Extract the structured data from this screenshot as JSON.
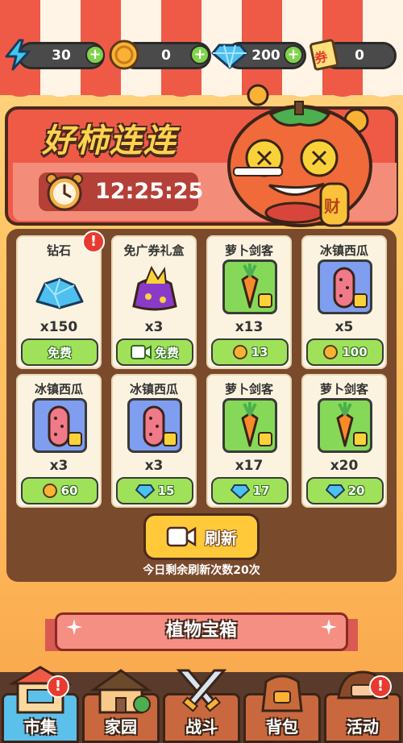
{
  "currencies": [
    {
      "name": "energy",
      "icon": "lightning-icon",
      "value": "30"
    },
    {
      "name": "coin",
      "icon": "coin-icon",
      "value": "0"
    },
    {
      "name": "diamond",
      "icon": "diamond-icon",
      "value": "200"
    },
    {
      "name": "ticket",
      "icon": "ticket-icon",
      "value": "0",
      "icon_text": "券"
    }
  ],
  "event": {
    "title": "好柿连连",
    "timer": "12:25:25",
    "mascot_badge": "财"
  },
  "shop": {
    "items": [
      {
        "name": "钻石",
        "qty": "x150",
        "icon": "diamond-pile-icon",
        "price_type": "free",
        "price": "免费",
        "alert": "!"
      },
      {
        "name": "免广券礼盒",
        "qty": "x3",
        "icon": "gift-bag-icon",
        "price_type": "video",
        "price": "免费"
      },
      {
        "name": "萝卜剑客",
        "qty": "x13",
        "icon": "carrot-icon",
        "price_type": "coin",
        "price": "13"
      },
      {
        "name": "冰镇西瓜",
        "qty": "x5",
        "icon": "watermelon-icon",
        "price_type": "coin",
        "price": "100"
      },
      {
        "name": "冰镇西瓜",
        "qty": "x3",
        "icon": "watermelon-icon",
        "price_type": "coin",
        "price": "60"
      },
      {
        "name": "冰镇西瓜",
        "qty": "x3",
        "icon": "watermelon-icon",
        "price_type": "diamond",
        "price": "15"
      },
      {
        "name": "萝卜剑客",
        "qty": "x17",
        "icon": "carrot-icon",
        "price_type": "diamond",
        "price": "17"
      },
      {
        "name": "萝卜剑客",
        "qty": "x20",
        "icon": "carrot-icon",
        "price_type": "diamond",
        "price": "20"
      }
    ],
    "refresh_label": "刷新",
    "refresh_note": "今日剩余刷新次数20次"
  },
  "chest": {
    "title": "植物宝箱"
  },
  "nav": {
    "tabs": [
      {
        "label": "市集",
        "icon": "market-stall-icon",
        "active": true,
        "alert": "!"
      },
      {
        "label": "家园",
        "icon": "house-icon",
        "active": false
      },
      {
        "label": "战斗",
        "icon": "crossed-swords-icon",
        "active": false
      },
      {
        "label": "背包",
        "icon": "backpack-icon",
        "active": false
      },
      {
        "label": "活动",
        "icon": "event-icon",
        "active": false,
        "alert": "!"
      }
    ]
  },
  "colors": {
    "accent_red": "#ef5a47",
    "button_green": "#9fe25a",
    "button_yellow": "#ffc93a",
    "panel_brown": "#7a4a2c"
  }
}
